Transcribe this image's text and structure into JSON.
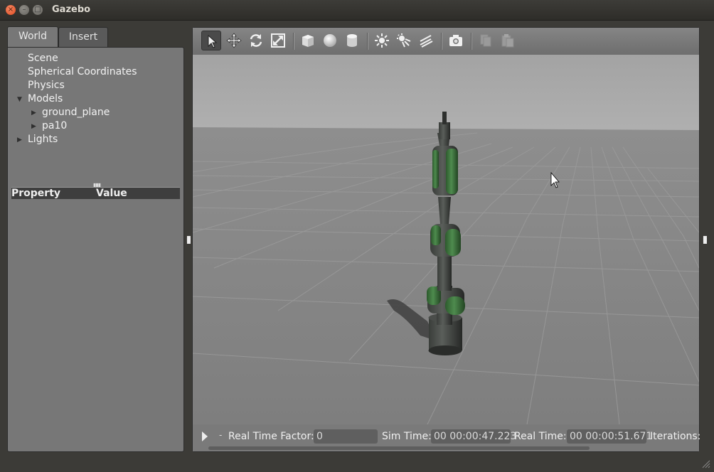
{
  "window": {
    "title": "Gazebo",
    "close_glyph": "×",
    "min_glyph": "–",
    "max_glyph": "□"
  },
  "left_panel": {
    "tabs": [
      {
        "label": "World",
        "active": true
      },
      {
        "label": "Insert",
        "active": false
      }
    ],
    "tree": [
      {
        "label": "Scene"
      },
      {
        "label": "Spherical Coordinates"
      },
      {
        "label": "Physics"
      },
      {
        "label": "Models",
        "expanded": true
      },
      {
        "label": "ground_plane",
        "collapsed_child": true
      },
      {
        "label": "pa10",
        "collapsed_child": true
      },
      {
        "label": "Lights",
        "expanded": false
      }
    ],
    "property_header": {
      "property": "Property",
      "value": "Value"
    }
  },
  "toolbar": {
    "tools": [
      {
        "icon": "select-arrow-icon",
        "active": true
      },
      {
        "icon": "translate-icon"
      },
      {
        "icon": "rotate-icon"
      },
      {
        "icon": "scale-icon"
      },
      {
        "icon": "box-shape-icon"
      },
      {
        "icon": "sphere-shape-icon"
      },
      {
        "icon": "cylinder-shape-icon"
      },
      {
        "icon": "point-light-icon"
      },
      {
        "icon": "spot-light-icon"
      },
      {
        "icon": "directional-light-icon"
      },
      {
        "icon": "screenshot-camera-icon"
      },
      {
        "icon": "copy-icon"
      },
      {
        "icon": "paste-icon"
      }
    ]
  },
  "status_bar": {
    "real_time_factor_label": "Real Time Factor:",
    "real_time_factor_value": "0",
    "sim_time_label": "Sim Time:",
    "sim_time_value": "00 00:00:47.223",
    "real_time_label": "Real Time:",
    "real_time_value": "00 00:00:51.671",
    "iterations_label": "Iterations:",
    "step_glyph": "-"
  },
  "colors": {
    "panel_bg": "#777777",
    "viewport_sky": "#a8a8a8",
    "ground": "#878787",
    "robot_accent": "#3f7a3f"
  }
}
